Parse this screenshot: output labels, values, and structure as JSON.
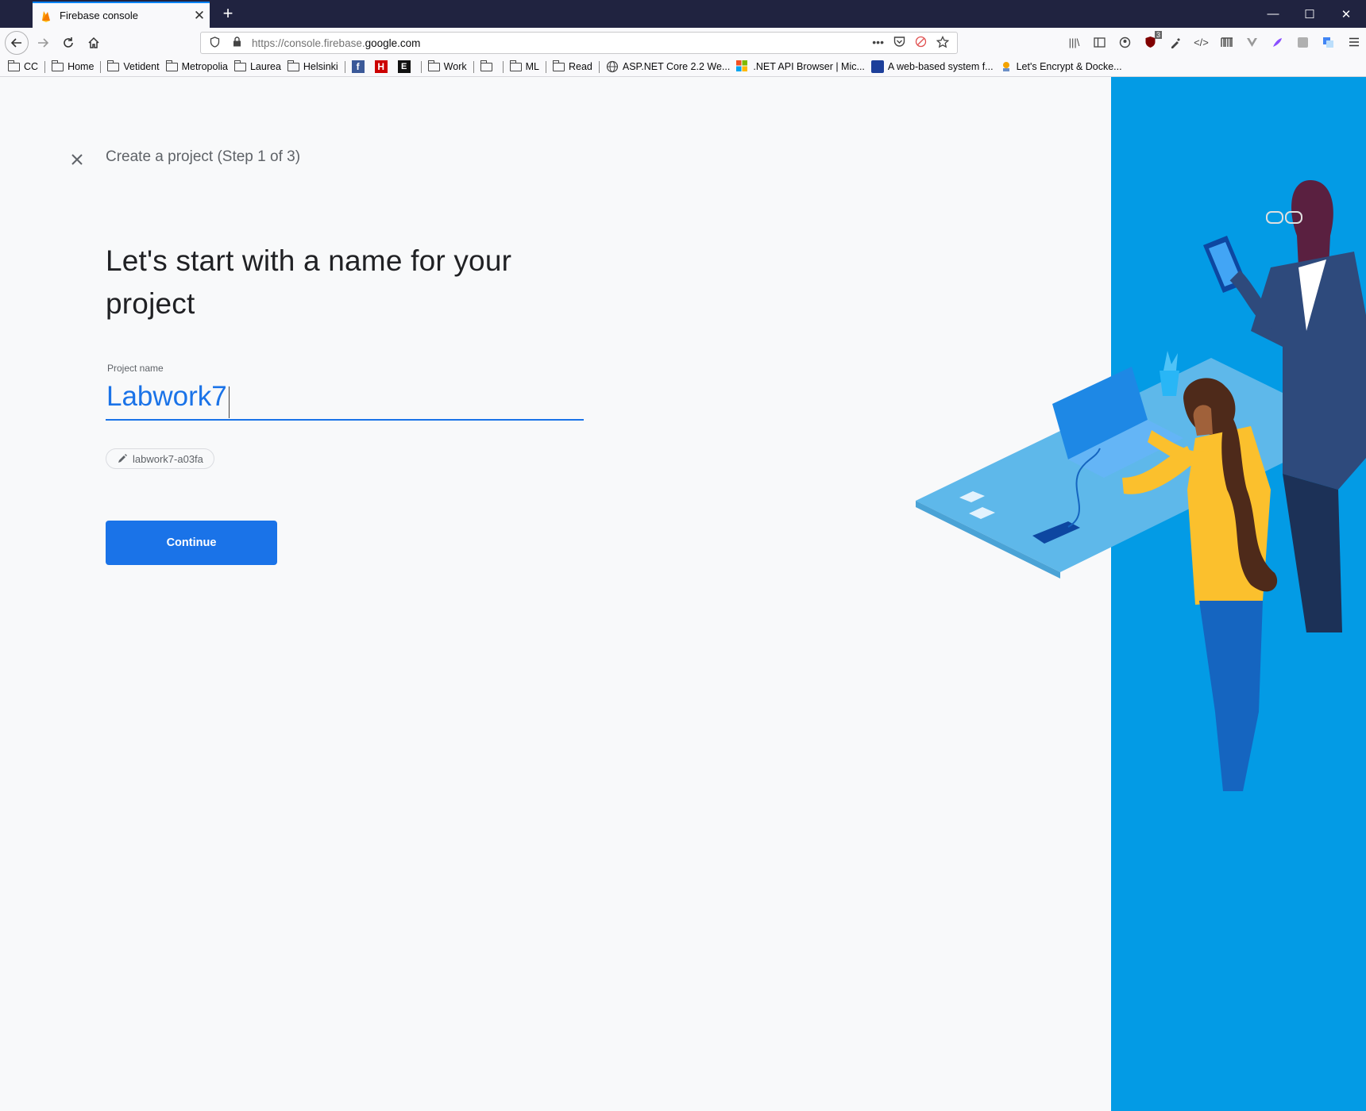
{
  "browser": {
    "tab_title": "Firebase console",
    "url_prefix": "https://console.firebase.",
    "url_domain": "google.com",
    "url_more": "•••",
    "extension_badge": "3"
  },
  "bookmarks": [
    {
      "label": "CC"
    },
    {
      "label": "Home"
    },
    {
      "label": "Vetident"
    },
    {
      "label": "Metropolia"
    },
    {
      "label": "Laurea"
    },
    {
      "label": "Helsinki"
    },
    {
      "label": "Work"
    },
    {
      "label": "ML"
    },
    {
      "label": "Read"
    },
    {
      "label": "ASP.NET Core 2.2 We..."
    },
    {
      "label": ".NET API Browser | Mic..."
    },
    {
      "label": "A web-based system f..."
    },
    {
      "label": "Let's Encrypt & Docke..."
    }
  ],
  "page": {
    "step_title": "Create a project (Step 1 of 3)",
    "heading": "Let's start with a name for your project",
    "field_label": "Project name",
    "field_value": "Labwork7",
    "project_id": "labwork7-a03fa",
    "continue_label": "Continue"
  },
  "colors": {
    "accent": "#1a73e8",
    "hero_blue": "#039be5",
    "titlebar": "#202340"
  }
}
